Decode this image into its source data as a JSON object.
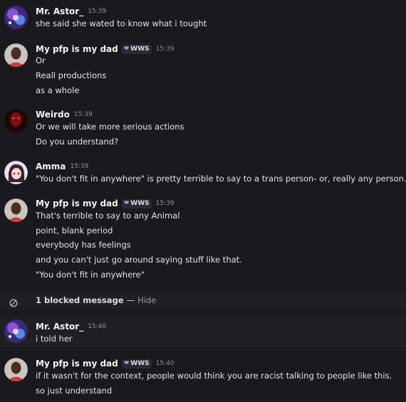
{
  "messages": [
    {
      "user": "Mr. Astor_",
      "time": "15:39",
      "lines": [
        "she said she wated to know what i tought"
      ]
    },
    {
      "user": "My pfp is my dad",
      "tag": "WWS",
      "time": "15:39",
      "lines": [
        "Or",
        "Reall productions",
        "as a whole"
      ]
    },
    {
      "user": "Weirdo",
      "time": "15:39",
      "lines": [
        "Or we will take more serious actions",
        "Do you understand?"
      ]
    },
    {
      "user": "Amma",
      "time": "15:39",
      "lines": [
        "\"You don't fit in anywhere\" is pretty terrible to say to a trans person- or, really any person."
      ]
    },
    {
      "user": "My pfp is my dad",
      "tag": "WWS",
      "time": "15:39",
      "lines": [
        "That's terrible to say to any Animal",
        "point, blank period",
        "everybody has feelings",
        "and you can't just go around saying stuff like that.",
        "\"You don't fit in anywhere\""
      ]
    },
    {
      "user": "Mr. Astor_",
      "time": "15:40",
      "lines": [
        "i told her"
      ]
    },
    {
      "user": "My pfp is my dad",
      "tag": "WWS",
      "time": "15:40",
      "lines": [
        "if it wasn't for the context, people would think you are racist talking to people like this.",
        "so just understand"
      ]
    }
  ],
  "blocked": {
    "text": "1 blocked message",
    "dash": "—",
    "action": "Hide"
  },
  "icons": {
    "astor": "galaxy-avatar-icon",
    "dad": "person-avatar-icon",
    "weirdo": "dark-red-avatar-icon",
    "amma": "anime-avatar-icon",
    "blocked": "blocked-circle-icon",
    "tag": "heart-icon"
  },
  "colors": {
    "background": "#1a1a1e",
    "blocked_row": "#202024",
    "tag_heart": "#b590ff"
  }
}
